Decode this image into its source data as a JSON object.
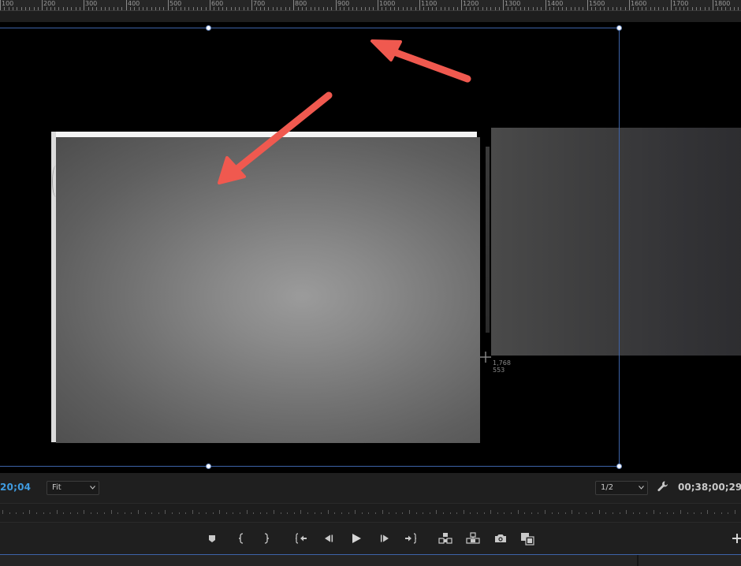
{
  "ruler": {
    "labels": [
      "100",
      "200",
      "300",
      "400",
      "500",
      "600",
      "700",
      "800",
      "900",
      "1000",
      "1100",
      "1200",
      "1300",
      "1400",
      "1500",
      "1600",
      "1700",
      "1800"
    ]
  },
  "cursor_readout": {
    "x": "1,768",
    "y": "553"
  },
  "controls": {
    "timecode_in": "20;04",
    "zoom_value": "Fit",
    "resolution_value": "1/2",
    "timecode_duration": "00;38;00;29"
  },
  "icons": {
    "wrench": "wrench-icon",
    "marker": "add-marker-icon",
    "mark_in": "mark-in-icon",
    "mark_out": "mark-out-icon",
    "go_to_in": "go-to-in-icon",
    "step_back": "step-back-icon",
    "play": "play-icon",
    "step_forward": "step-forward-icon",
    "go_to_out": "go-to-out-icon",
    "insert": "insert-icon",
    "overwrite": "overwrite-icon",
    "export_frame": "camera-icon",
    "compare": "compare-view-icon",
    "add": "plus-icon"
  },
  "colors": {
    "annotation_arrow": "#f0594f",
    "frame_outline": "#3d63a8",
    "timecode_accent": "#3f9be0"
  }
}
